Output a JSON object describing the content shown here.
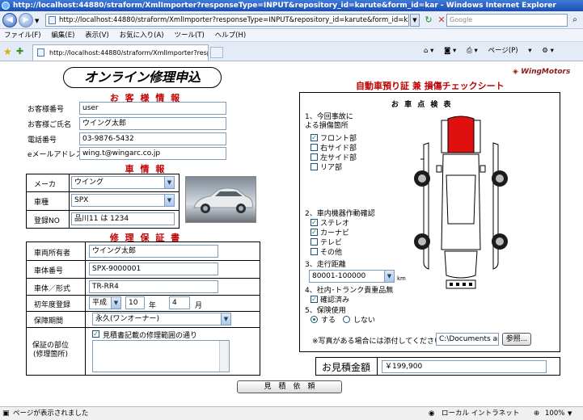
{
  "window": {
    "title": "http://localhost:44880/straform/XmlImporter?responseType=INPUT&repository_id=karute&form_id=kar - Windows Internet Explorer"
  },
  "address_bar": {
    "url": "http://localhost:44880/straform/XmlImporter?responseType=INPUT&repository_id=karute&form_id=karute",
    "search_placeholder": "Google"
  },
  "menu": [
    "ファイル(F)",
    "編集(E)",
    "表示(V)",
    "お気に入り(A)",
    "ツール(T)",
    "ヘルプ(H)"
  ],
  "tab": {
    "title": "http://localhost:44880/straform/XmlImporter?respo..."
  },
  "toolbar": {
    "page_label": "ページ(P)"
  },
  "form": {
    "title": "オンライン修理申込",
    "customer": {
      "heading": "お 客 様 情 報",
      "number_label": "お客様番号",
      "number_value": "user",
      "name_label": "お客様ご氏名",
      "name_value": "ウイング太郎",
      "phone_label": "電話番号",
      "phone_value": "03-9876-5432",
      "email_label": "eメールアドレス",
      "email_value": "wing.t@wingarc.co.jp"
    },
    "vehicle": {
      "heading": "車 情 報",
      "maker_label": "メーカ",
      "maker_value": "ウイング",
      "model_label": "車種",
      "model_value": "SPX",
      "reg_label": "登録NO",
      "reg_value": "品川11 は 1234"
    },
    "warranty": {
      "heading": "修 理 保 証 書",
      "owner_label": "車両所有者",
      "owner_value": "ウイング太郎",
      "body_no_label": "車体番号",
      "body_no_value": "SPX-9000001",
      "type_label": "車体／形式",
      "type_value": "TR-RR4",
      "first_reg_label": "初年度登録",
      "era_value": "平成",
      "year_value": "10",
      "year_unit": "年",
      "month_value": "4",
      "month_unit": "月",
      "period_label": "保障期間",
      "period_value": "永久(ワンオーナー)",
      "parts_label": "保証の部位\n(修理箇所)",
      "parts_check_label": "見積書記載の修理範囲の通り"
    },
    "submit_label": "見　積　依　頼"
  },
  "check_sheet": {
    "title": "自動車預り証 兼 損傷チェックシート",
    "brand": "WingMotors",
    "inspection_heading": "お 車 点 検 表",
    "q1": "1、今回事故に\nよる損傷箇所",
    "damage": [
      {
        "label": "フロント部",
        "checked": true
      },
      {
        "label": "右サイド部",
        "checked": false
      },
      {
        "label": "左サイド部",
        "checked": false
      },
      {
        "label": "リア部",
        "checked": false
      }
    ],
    "q2": "2、車内機器作動確認",
    "equipment": [
      {
        "label": "ステレオ",
        "checked": true
      },
      {
        "label": "カーナビ",
        "checked": true
      },
      {
        "label": "テレビ",
        "checked": false
      },
      {
        "label": "その他",
        "checked": false
      }
    ],
    "q3": "3、走行距離",
    "mileage_value": "80001-100000",
    "mileage_unit": "km",
    "q4": "4、社内･トランク貴重品無",
    "confirmed_label": "確認済み",
    "q5": "5、保険使用",
    "insurance_yes": "する",
    "insurance_no": "しない",
    "photo_note": "※写真がある場合には添付してください",
    "file_value": "C:\\Documents and",
    "browse_label": "参照...",
    "estimate_label": "お見積金額",
    "estimate_value": "￥199,900"
  },
  "status": {
    "text": "ページが表示されました",
    "zone": "ローカル イントラネット",
    "zoom": "100%"
  },
  "colors": {
    "accent_red": "#c00000",
    "damage_red": "#e01010"
  }
}
